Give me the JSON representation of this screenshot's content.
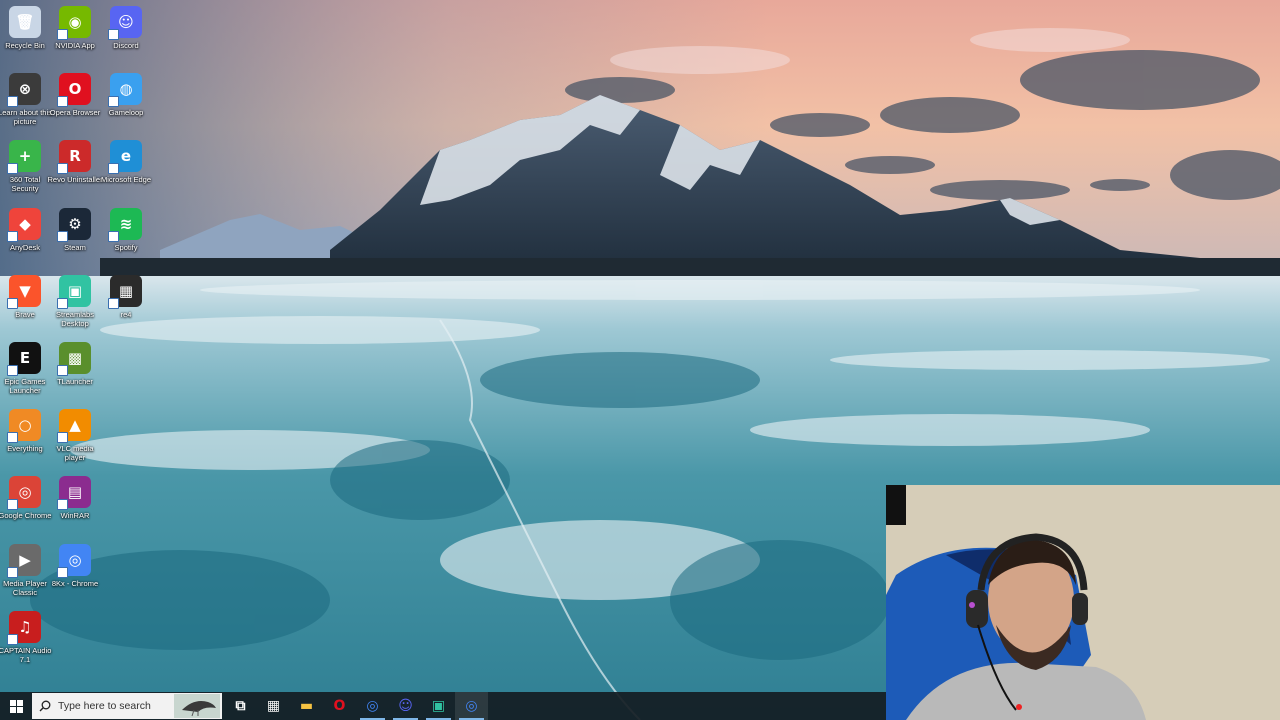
{
  "desktop": {
    "icons": [
      {
        "label": "Recycle Bin",
        "icon": "recycle-bin-icon",
        "color": "#c9d6e6"
      },
      {
        "label": "NVIDIA App",
        "icon": "nvidia-icon",
        "color": "#76b900"
      },
      {
        "label": "Discord",
        "icon": "discord-icon",
        "color": "#5865f2"
      },
      {
        "label": "Learn about this picture",
        "icon": "learn-picture-icon",
        "color": "#3b3b3b"
      },
      {
        "label": "Opera Browser",
        "icon": "opera-icon",
        "color": "#e0101f"
      },
      {
        "label": "Gameloop",
        "icon": "gameloop-icon",
        "color": "#3aa0ef"
      },
      {
        "label": "360 Total Security",
        "icon": "shield-plus-icon",
        "color": "#39b54a"
      },
      {
        "label": "Revo Uninstaller",
        "icon": "revo-icon",
        "color": "#cc2a2a"
      },
      {
        "label": "Microsoft Edge",
        "icon": "edge-icon",
        "color": "#1f8fd6"
      },
      {
        "label": "AnyDesk",
        "icon": "anydesk-icon",
        "color": "#ef443b"
      },
      {
        "label": "Steam",
        "icon": "steam-icon",
        "color": "#1b2838"
      },
      {
        "label": "Spotify",
        "icon": "spotify-icon",
        "color": "#1db954"
      },
      {
        "label": "Brave",
        "icon": "brave-icon",
        "color": "#fb542b"
      },
      {
        "label": "Streamlabs Desktop",
        "icon": "streamlabs-icon",
        "color": "#31c3a2"
      },
      {
        "label": "re4",
        "icon": "re4-icon",
        "color": "#2b2b2b"
      },
      {
        "label": "Epic Games Launcher",
        "icon": "epic-games-icon",
        "color": "#111111"
      },
      {
        "label": "TLauncher",
        "icon": "minecraft-block-icon",
        "color": "#5a8f2c"
      },
      {
        "label": "Everything",
        "icon": "everything-icon",
        "color": "#f08a24"
      },
      {
        "label": "VLC media player",
        "icon": "vlc-cone-icon",
        "color": "#f28c00"
      },
      {
        "label": "Google Chrome",
        "icon": "chrome-icon",
        "color": "#db4437"
      },
      {
        "label": "WinRAR",
        "icon": "winrar-icon",
        "color": "#8b2c8f"
      },
      {
        "label": "Media Player Classic",
        "icon": "media-player-icon",
        "color": "#6a6a6a"
      },
      {
        "label": "8Kx - Chrome",
        "icon": "chrome-profile-icon",
        "color": "#4285f4"
      },
      {
        "label": "CAPTAIN Audio 7.1",
        "icon": "captain-audio-icon",
        "color": "#c81e1e"
      }
    ]
  },
  "taskbar": {
    "search_placeholder": "Type here to search",
    "items": [
      {
        "name": "task-view-icon",
        "color": "#ffffff"
      },
      {
        "name": "store-icon",
        "color": "#f2f2f2"
      },
      {
        "name": "file-explorer-icon",
        "color": "#f6c343"
      },
      {
        "name": "opera-icon",
        "color": "#e0101f"
      },
      {
        "name": "chrome-icon",
        "color": "#4285f4"
      },
      {
        "name": "discord-icon",
        "color": "#5865f2"
      },
      {
        "name": "streamlabs-icon",
        "color": "#31c3a2"
      },
      {
        "name": "chrome-profile-icon",
        "color": "#4285f4"
      }
    ]
  }
}
